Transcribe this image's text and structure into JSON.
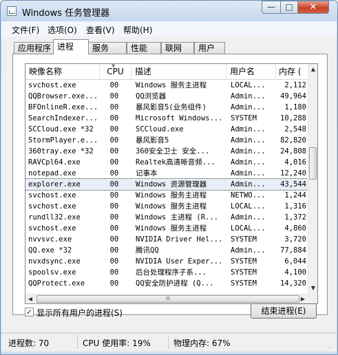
{
  "window": {
    "title": "Windows 任务管理器",
    "minimize": "—",
    "maximize": "□",
    "close": "✕"
  },
  "menu": [
    "文件(F)",
    "选项(O)",
    "查看(V)",
    "帮助(H)"
  ],
  "tabs": [
    "应用程序",
    "进程",
    "服务",
    "性能",
    "联网",
    "用户"
  ],
  "active_tab": "进程",
  "table": {
    "columns": [
      "映像名称",
      "CPU",
      "描述",
      "用户名",
      "内存 ("
    ],
    "rows": [
      {
        "name": "svchost.exe",
        "cpu": "00",
        "desc": "Windows 服务主进程",
        "user": "LOCAL...",
        "mem": "2,112"
      },
      {
        "name": "QQBrowser.exe...",
        "cpu": "00",
        "desc": "QQ浏览器",
        "user": "Admin...",
        "mem": "49,964"
      },
      {
        "name": "BFOnlineR.exe...",
        "cpu": "00",
        "desc": "暴风影音5(业务组件)",
        "user": "Admin...",
        "mem": "1,180"
      },
      {
        "name": "SearchIndexer...",
        "cpu": "00",
        "desc": "Microsoft Windows...",
        "user": "SYSTEM",
        "mem": "10,288"
      },
      {
        "name": "SCCloud.exe *32",
        "cpu": "00",
        "desc": "SCCloud.exe",
        "user": "Admin...",
        "mem": "2,548"
      },
      {
        "name": "StormPlayer.e...",
        "cpu": "00",
        "desc": "暴风影音5",
        "user": "Admin...",
        "mem": "82,820"
      },
      {
        "name": "360tray.exe *32",
        "cpu": "00",
        "desc": "360安全卫士 安全...",
        "user": "Admin...",
        "mem": "24,808"
      },
      {
        "name": "RAVCpl64.exe",
        "cpu": "00",
        "desc": "Realtek高清晰音频...",
        "user": "Admin...",
        "mem": "4,016"
      },
      {
        "name": "notepad.exe",
        "cpu": "00",
        "desc": "记事本",
        "user": "Admin...",
        "mem": "12,240"
      },
      {
        "name": "explorer.exe",
        "cpu": "00",
        "desc": "Windows 资源管理器",
        "user": "Admin...",
        "mem": "43,544",
        "selected": true
      },
      {
        "name": "svchost.exe",
        "cpu": "00",
        "desc": "Windows 服务主进程",
        "user": "NETWO...",
        "mem": "1,244"
      },
      {
        "name": "svchost.exe",
        "cpu": "00",
        "desc": "Windows 服务主进程",
        "user": "LOCAL...",
        "mem": "1,316"
      },
      {
        "name": "rundll32.exe",
        "cpu": "00",
        "desc": "Windows 主进程 (R...",
        "user": "Admin...",
        "mem": "1,372"
      },
      {
        "name": "svchost.exe",
        "cpu": "00",
        "desc": "Windows 服务主进程",
        "user": "LOCAL...",
        "mem": "4,860"
      },
      {
        "name": "nvvsvc.exe",
        "cpu": "00",
        "desc": "NVIDIA Driver Hel...",
        "user": "SYSTEM",
        "mem": "3,720"
      },
      {
        "name": "QQ.exe *32",
        "cpu": "00",
        "desc": "腾讯QQ",
        "user": "Admin...",
        "mem": "77,884"
      },
      {
        "name": "nvxdsync.exe",
        "cpu": "00",
        "desc": "NVIDIA User Exper...",
        "user": "SYSTEM",
        "mem": "6,044"
      },
      {
        "name": "spoolsv.exe",
        "cpu": "00",
        "desc": "后台处理程序子系...",
        "user": "SYSTEM",
        "mem": "4,100"
      },
      {
        "name": "QQProtect.exe",
        "cpu": "00",
        "desc": "QQ安全防护进程 (Q...",
        "user": "SYSTEM",
        "mem": "14,320"
      }
    ]
  },
  "show_all_users": {
    "label": "显示所有用户的进程(S)",
    "checked": true
  },
  "end_process_button": "结束进程(E)",
  "status": {
    "processes": "进程数: 70",
    "cpu": "CPU 使用率: 19%",
    "memory": "物理内存: 67%"
  },
  "scrollbar": {
    "h_thumb": "III"
  }
}
